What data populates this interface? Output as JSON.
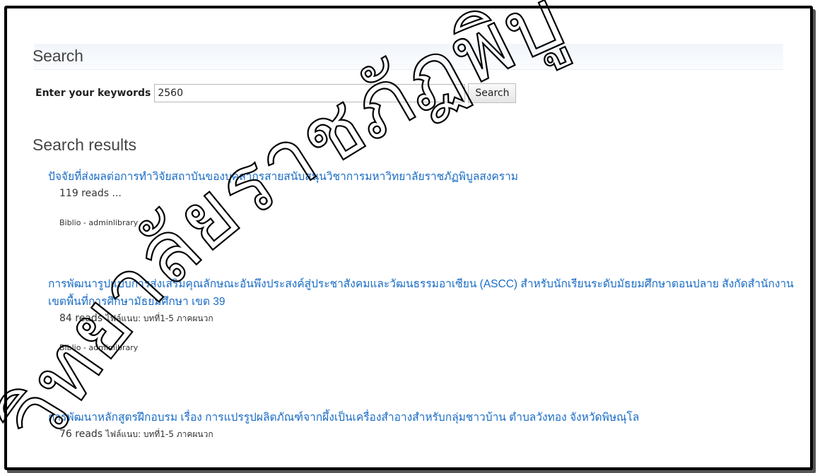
{
  "search": {
    "heading": "Search",
    "keyword_label": "Enter your keywords",
    "keyword_value": "2560",
    "button_label": "Search"
  },
  "results": {
    "heading": "Search results",
    "items": [
      {
        "title": "ปัจจัยที่ส่งผลต่อการทำวิจัยสถาบันของบุคลากรสายสนับสนุนวิชาการมหาวิทยาลัยราชภัฏพิบูลสงคราม",
        "reads": "119 reads ...",
        "files": "",
        "biblio": "Biblio - adminlibrary"
      },
      {
        "title": "การพัฒนารูปแบบการส่งเสริมคุณลักษณะอันพึงประสงค์สู่ประชาสังคมและวัฒนธรรมอาเซียน (ASCC) สำหรับนักเรียนระดับมัธยมศึกษาตอนปลาย สังกัดสำนักงานเขตพื้นที่การศึกษามัธยมศึกษา เขต 39",
        "reads": "84 reads",
        "files": "ไฟล์แนบ:  บทที่1-5 ภาคผนวก",
        "biblio": "Biblio - adminlibrary"
      },
      {
        "title": "การพัฒนาหลักสูตรฝึกอบรม เรื่อง การแปรรูปผลิตภัณฑ์จากผึ้งเป็นเครื่องสำอางสำหรับกลุ่มชาวบ้าน ตำบลวังทอง จังหวัดพิษณุโล",
        "reads": "76 reads",
        "files": "ไฟล์แนบ:  บทที่1-5 ภาคผนวก",
        "biblio": ""
      }
    ]
  },
  "watermark": {
    "text": "วิทยาลัยราชภัฏพิบูลสงคราม",
    "color": "#000000"
  },
  "colors": {
    "link": "#1a6cc6",
    "heading": "#444444",
    "frame": "#000000"
  }
}
